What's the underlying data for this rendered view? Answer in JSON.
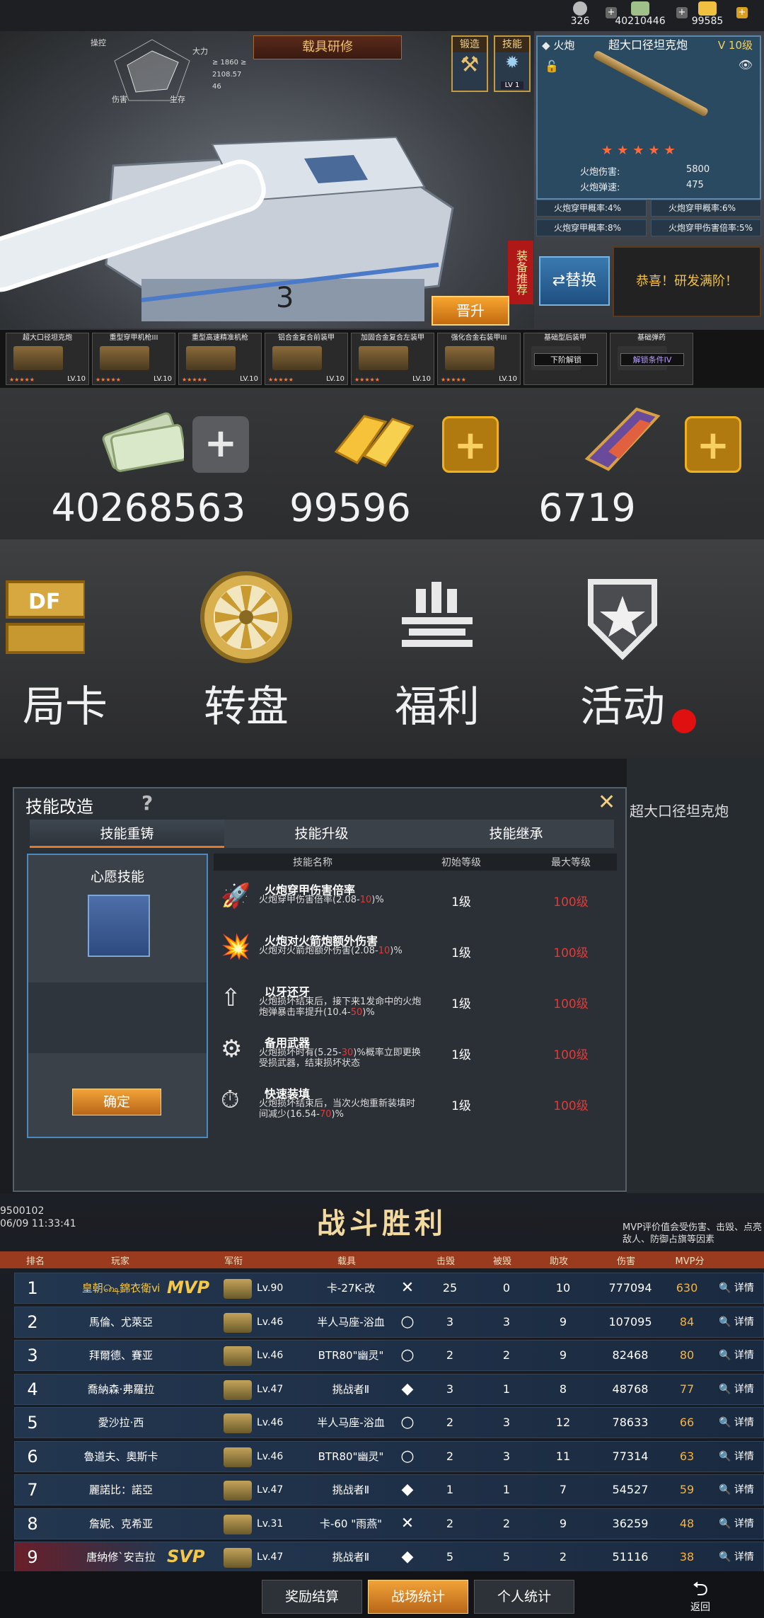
{
  "panel1": {
    "resources": [
      {
        "value": "326",
        "icon": "medal-icon",
        "color": "#c8c8c8"
      },
      {
        "value": "40210446",
        "icon": "cash-icon",
        "color": "#a0c08a"
      },
      {
        "value": "99585",
        "icon": "gold-icon",
        "color": "#f0c040"
      }
    ],
    "radar_labels": [
      "操控",
      "大力",
      "伤害",
      "生存"
    ],
    "stats": [
      "≥ 1860 ≥",
      "2108.57",
      "46"
    ],
    "tab_title": "载具研修",
    "side_buttons": [
      {
        "label": "锻造",
        "icon": "hammer-icon"
      },
      {
        "label": "技能",
        "icon": "skill-icon",
        "level": "LV 1"
      }
    ],
    "equip_recommend": "装备推荐",
    "promote": "晋升",
    "card": {
      "class": "火炮",
      "name": "超大口径坦克炮",
      "level": "V 10级",
      "stars": "★★★★★",
      "stats": [
        {
          "label": "火炮伤害:",
          "value": "5800"
        },
        {
          "label": "火炮弹速:",
          "value": "475"
        }
      ]
    },
    "subprops": [
      "火炮穿甲概率:4%",
      "火炮穿甲概率:6%",
      "火炮穿甲概率:8%",
      "火炮穿甲伤害倍率:5%"
    ],
    "swap": "替换",
    "max_banner": "恭喜！研发满阶！",
    "slots": [
      {
        "title": "超大口径坦克炮",
        "lv": "LV.10",
        "stars": "★★★★★"
      },
      {
        "title": "重型穿甲机枪III",
        "lv": "LV.10",
        "stars": "★★★★★"
      },
      {
        "title": "重型高速精准机枪",
        "lv": "LV.10",
        "stars": "★★★★★"
      },
      {
        "title": "铝合金复合前装甲",
        "lv": "LV.10",
        "stars": "★★★★★"
      },
      {
        "title": "加固合金复合左装甲",
        "lv": "LV.10",
        "stars": "★★★★★"
      },
      {
        "title": "强化合金右装甲III",
        "lv": "LV.10",
        "stars": "★★★★★"
      },
      {
        "title": "基础型后装甲",
        "lock": "下阶解锁"
      },
      {
        "title": "基础弹药",
        "lock": "解锁条件IV"
      }
    ]
  },
  "panel2": {
    "resources": [
      {
        "value": "40268563",
        "icon": "cash-stack-icon"
      },
      {
        "value": "99596",
        "icon": "gold-bars-icon"
      },
      {
        "value": "6719",
        "icon": "crystal-icon"
      }
    ],
    "menu": [
      {
        "label": "局卡",
        "icon": "df-badge-icon"
      },
      {
        "label": "转盘",
        "icon": "wheel-icon"
      },
      {
        "label": "福利",
        "icon": "gift-icon"
      },
      {
        "label": "活动",
        "icon": "star-shield-icon"
      }
    ]
  },
  "panel3": {
    "title": "技能改造",
    "tabs": [
      "技能重铸",
      "技能升级",
      "技能继承"
    ],
    "wish_title": "心愿技能",
    "confirm": "确定",
    "headers": [
      "技能名称",
      "初始等级",
      "最大等级"
    ],
    "skills": [
      {
        "name": "火炮穿甲伤害倍率",
        "desc_a": "火炮穿甲伤害倍率(2.08-",
        "desc_hi": "10",
        "desc_b": ")%",
        "init": "1级",
        "max": "100级"
      },
      {
        "name": "火炮对火箭炮额外伤害",
        "desc_a": "火炮对火箭炮额外伤害(2.08-",
        "desc_hi": "10",
        "desc_b": ")%",
        "init": "1级",
        "max": "100级"
      },
      {
        "name": "以牙还牙",
        "desc_a": "火炮损坏结束后，接下来1发命中的火炮炮弹暴击率提升(10.4-",
        "desc_hi": "50",
        "desc_b": ")%",
        "init": "1级",
        "max": "100级"
      },
      {
        "name": "备用武器",
        "desc_a": "火炮损坏时有(5.25-",
        "desc_hi": "30",
        "desc_b": ")%概率立即更换受损武器，结束损坏状态",
        "init": "1级",
        "max": "100级"
      },
      {
        "name": "快速装填",
        "desc_a": "火炮损坏结束后，当次火炮重新装填时间减少(16.54-",
        "desc_hi": "70",
        "desc_b": ")%",
        "init": "1级",
        "max": "100级"
      }
    ],
    "bg_text": "超大口径坦克炮"
  },
  "panel4": {
    "meta": [
      "9500102",
      "06/09 11:33:41"
    ],
    "title": "战斗胜利",
    "note": "MVP评价值会受伤害、击毁、点亮敌人、防御占旗等因素",
    "headers": [
      "排名",
      "玩家",
      "军衔",
      "载具",
      "击毁",
      "被毁",
      "助攻",
      "伤害",
      "MVP分"
    ],
    "rows": [
      {
        "rank": "1",
        "name": "皇朝௸錦衣衛ⅵ",
        "badge": "MVP",
        "lv": "Lv.90",
        "veh": "卡-27K-改",
        "mode": "✕",
        "k": "25",
        "d": "0",
        "a": "10",
        "dmg": "777094",
        "mvp": "630",
        "det": "🔍 详情"
      },
      {
        "rank": "2",
        "name": "馬倫、尤萊亞",
        "badge": "",
        "lv": "Lv.46",
        "veh": "半人马座-浴血",
        "mode": "○",
        "k": "3",
        "d": "3",
        "a": "9",
        "dmg": "107095",
        "mvp": "84",
        "det": "🔍 详情"
      },
      {
        "rank": "3",
        "name": "拜爾德、賽亚",
        "badge": "",
        "lv": "Lv.46",
        "veh": "BTR80\"幽灵\"",
        "mode": "○",
        "k": "2",
        "d": "2",
        "a": "9",
        "dmg": "82468",
        "mvp": "80",
        "det": "🔍 详情"
      },
      {
        "rank": "4",
        "name": "喬納森·弗羅拉",
        "badge": "",
        "lv": "Lv.47",
        "veh": "挑战者Ⅱ",
        "mode": "◆",
        "k": "3",
        "d": "1",
        "a": "8",
        "dmg": "48768",
        "mvp": "77",
        "det": "🔍 详情"
      },
      {
        "rank": "5",
        "name": "愛沙拉·西",
        "badge": "",
        "lv": "Lv.46",
        "veh": "半人马座-浴血",
        "mode": "○",
        "k": "2",
        "d": "3",
        "a": "12",
        "dmg": "78633",
        "mvp": "66",
        "det": "🔍 详情"
      },
      {
        "rank": "6",
        "name": "魯道夫、奧斯卡",
        "badge": "",
        "lv": "Lv.46",
        "veh": "BTR80\"幽灵\"",
        "mode": "○",
        "k": "2",
        "d": "3",
        "a": "11",
        "dmg": "77314",
        "mvp": "63",
        "det": "🔍 详情"
      },
      {
        "rank": "7",
        "name": "麗諾比：諾亞",
        "badge": "",
        "lv": "Lv.47",
        "veh": "挑战者Ⅱ",
        "mode": "◆",
        "k": "1",
        "d": "1",
        "a": "7",
        "dmg": "54527",
        "mvp": "59",
        "det": "🔍 详情"
      },
      {
        "rank": "8",
        "name": "詹妮、克希亚",
        "badge": "",
        "lv": "Lv.31",
        "veh": "卡-60 \"雨燕\"",
        "mode": "✕",
        "k": "2",
        "d": "2",
        "a": "9",
        "dmg": "36259",
        "mvp": "48",
        "det": "🔍 详情"
      },
      {
        "rank": "9",
        "name": "唐纳修`安吉拉",
        "badge": "SVP",
        "lv": "Lv.47",
        "veh": "挑战者Ⅱ",
        "mode": "◆",
        "k": "5",
        "d": "5",
        "a": "2",
        "dmg": "51116",
        "mvp": "38",
        "det": "🔍 详情"
      }
    ],
    "buttons": [
      "奖励结算",
      "战场统计",
      "个人统计"
    ],
    "back": "返回"
  }
}
